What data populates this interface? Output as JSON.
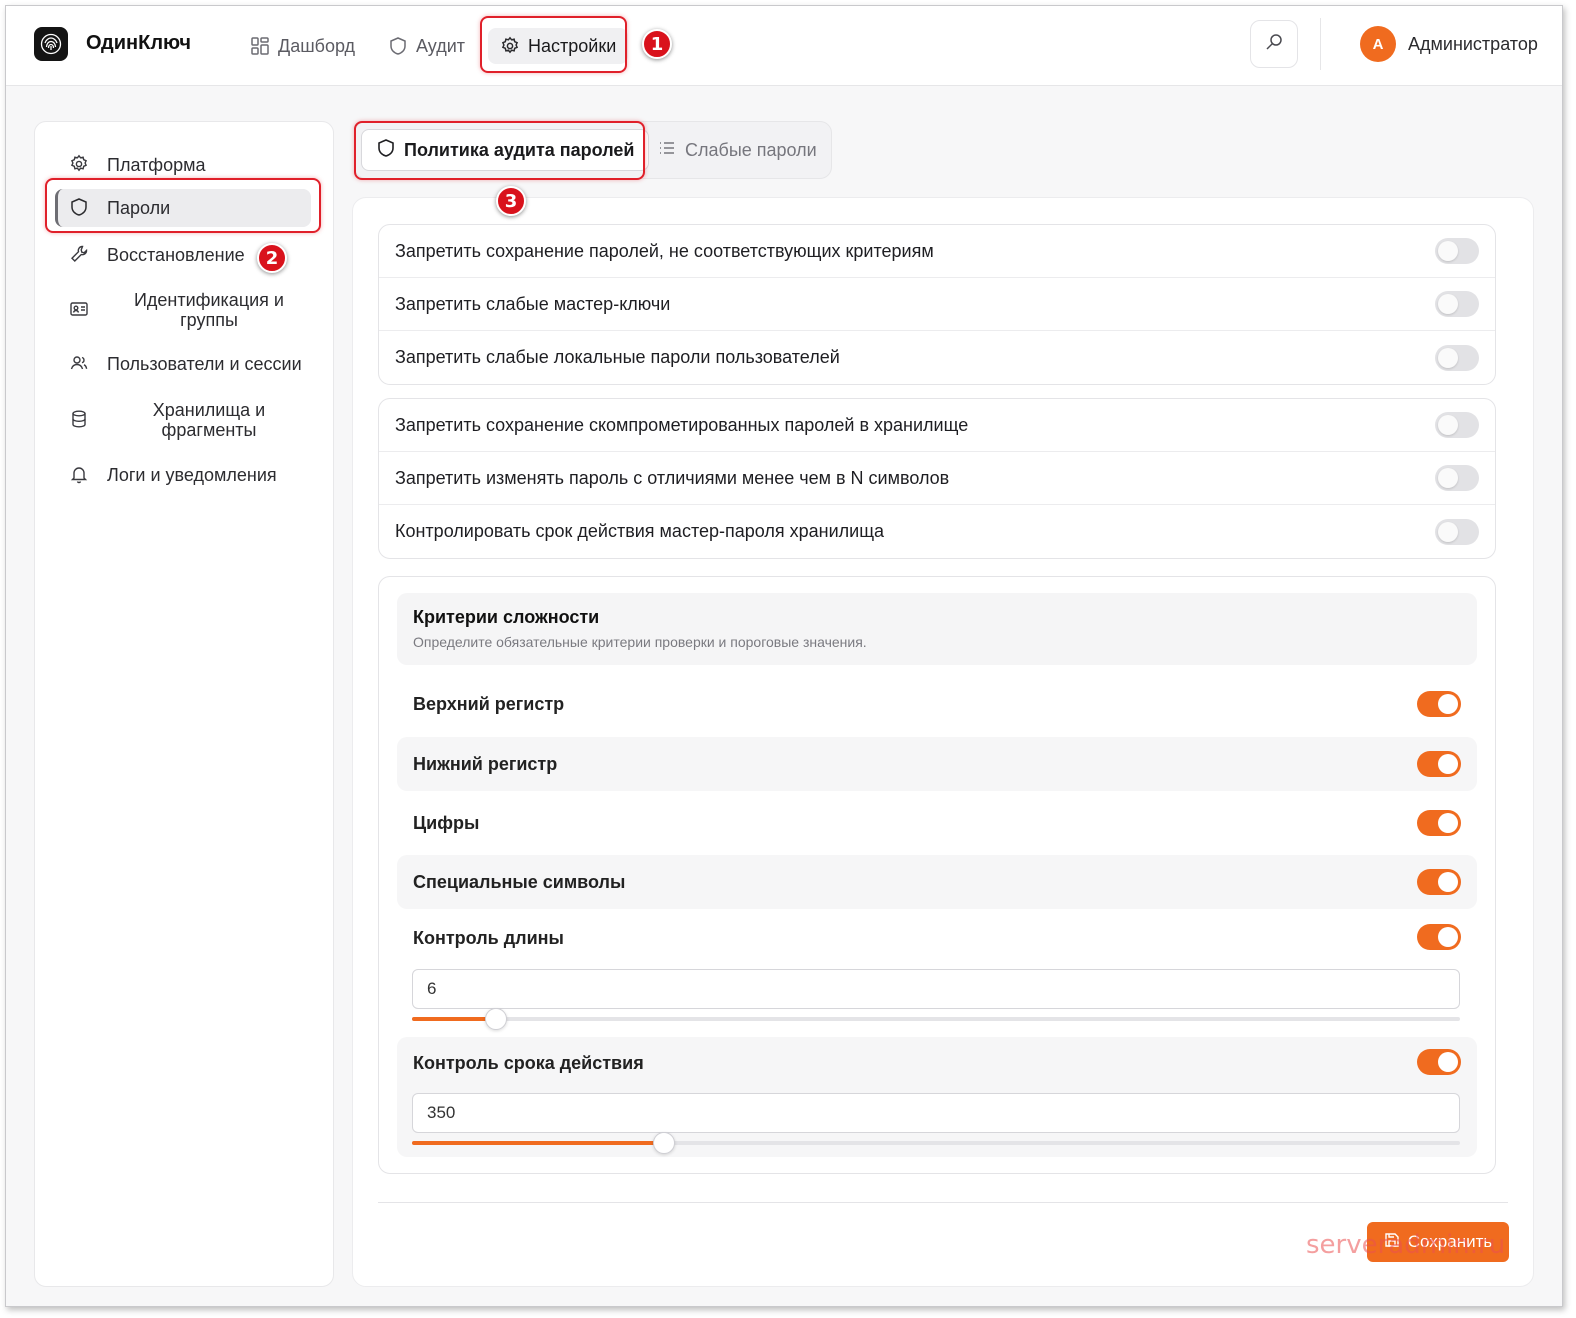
{
  "app": {
    "brand": "ОдинКлюч"
  },
  "nav": {
    "dashboard": "Дашборд",
    "audit": "Аудит",
    "settings": "Настройки"
  },
  "user": {
    "avatar_letter": "А",
    "name": "Администратор"
  },
  "sidebar": {
    "items": [
      {
        "label": "Платформа",
        "icon": "gear-icon"
      },
      {
        "label": "Пароли",
        "icon": "shield-icon",
        "active": true
      },
      {
        "label": "Восстановление",
        "icon": "wrench-icon"
      },
      {
        "label": "Идентификация и группы",
        "icon": "id-card-icon"
      },
      {
        "label": "Пользователи и сессии",
        "icon": "users-icon"
      },
      {
        "label": "Хранилища и фрагменты",
        "icon": "database-icon"
      },
      {
        "label": "Логи и уведомления",
        "icon": "bell-icon"
      }
    ]
  },
  "tabs": {
    "policy": "Политика аудита паролей",
    "weak": "Слабые пароли"
  },
  "group1": [
    {
      "label": "Запретить сохранение паролей, не соответствующих критериям",
      "on": false
    },
    {
      "label": "Запретить слабые мастер-ключи",
      "on": false
    },
    {
      "label": "Запретить слабые локальные пароли пользователей",
      "on": false
    }
  ],
  "group2": [
    {
      "label": "Запретить сохранение скомпрометированных паролей в хранилище",
      "on": false
    },
    {
      "label": "Запретить изменять пароль с отличиями менее чем в N символов",
      "on": false
    },
    {
      "label": "Контролировать срок действия мастер-пароля хранилища",
      "on": false
    }
  ],
  "criteria": {
    "title": "Критерии сложности",
    "subtitle": "Определите обязательные критерии проверки и пороговые значения.",
    "uppercase": "Верхний регистр",
    "lowercase": "Нижний регистр",
    "digits": "Цифры",
    "special": "Специальные символы",
    "length": {
      "label": "Контроль длины",
      "value": "6",
      "slider_fraction": 0.08
    },
    "expiry": {
      "label": "Контроль срока действия",
      "value": "350",
      "slider_fraction": 0.24
    }
  },
  "actions": {
    "save": "Сохранить"
  },
  "watermark": "serveradmin.ru",
  "annotations": [
    "1",
    "2",
    "3"
  ],
  "colors": {
    "accent": "#f06b1f",
    "highlight": "#e0202a"
  }
}
